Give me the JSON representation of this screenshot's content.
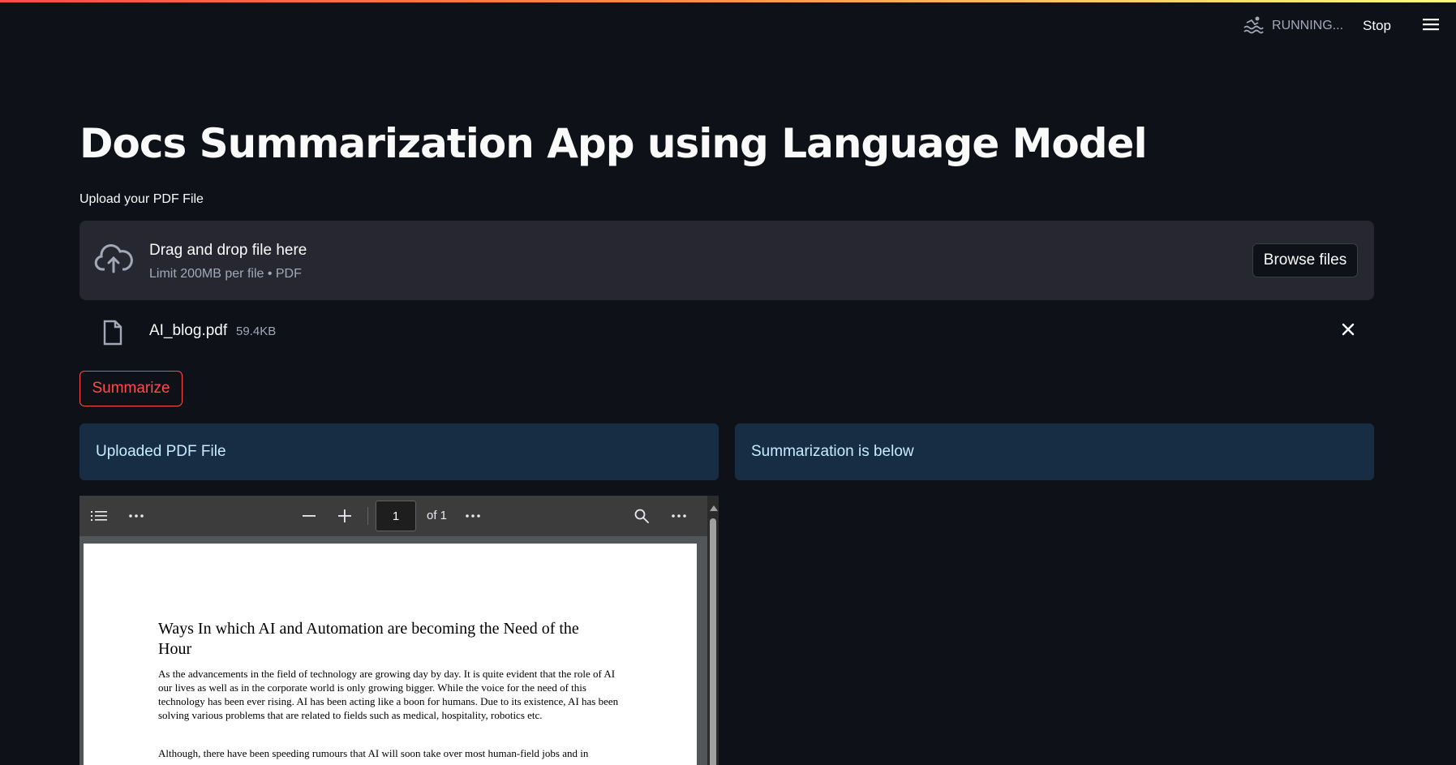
{
  "header": {
    "status": "RUNNING...",
    "stop_label": "Stop"
  },
  "app": {
    "title": "Docs Summarization App using Language Model",
    "upload_label": "Upload your PDF File"
  },
  "uploader": {
    "drag_text": "Drag and drop file here",
    "limit_text": "Limit 200MB per file • PDF",
    "browse_label": "Browse files"
  },
  "file": {
    "name": "AI_blog.pdf",
    "size": "59.4KB"
  },
  "summarize_label": "Summarize",
  "columns": {
    "left_info": "Uploaded PDF File",
    "right_info": "Summarization is below"
  },
  "pdf_viewer": {
    "page_number": "1",
    "page_total": "of 1",
    "doc_title": "Ways In which AI and Automation are becoming the Need of the Hour",
    "paragraph1": "As the advancements in the field of technology are growing day by day. It is quite evident that the role of AI our lives as well as in the corporate world is only growing bigger. While the voice for the need of this technology has been ever rising. AI has been acting like a boon for humans. Due to its existence, AI has been solving various problems that are related to fields such as medical, hospitality, robotics etc.",
    "paragraph2": "Although, there have been speeding rumours that AI will soon take over most human-field jobs and in"
  },
  "colors": {
    "background": "#0e1117",
    "accent": "#ff4b4b",
    "info_bg": "#172d43",
    "info_text": "#c7ebff",
    "dropzone_bg": "#262730"
  },
  "icons": [
    "swimmer-icon",
    "hamburger-menu-icon",
    "cloud-upload-icon",
    "file-icon",
    "close-icon",
    "outline-icon",
    "more-options-icon",
    "zoom-out-icon",
    "zoom-in-icon",
    "search-icon"
  ]
}
